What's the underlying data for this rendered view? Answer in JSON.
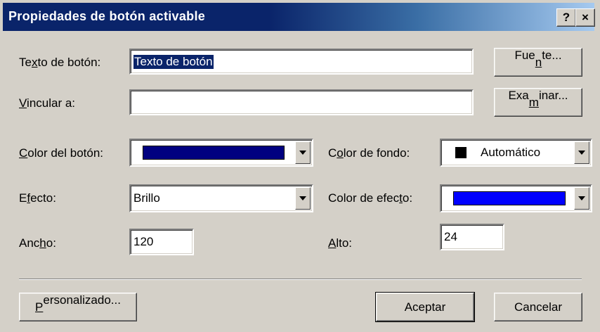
{
  "window": {
    "title": "Propiedades de botón activable",
    "help_label": "?",
    "close_label": "×"
  },
  "form": {
    "text": {
      "label_pre": "Te",
      "label_key": "x",
      "label_post": "to de botón:",
      "value": "Texto de botón"
    },
    "link": {
      "label_pre": "",
      "label_key": "V",
      "label_post": "incular a:",
      "value": ""
    },
    "button_color": {
      "label_pre": "",
      "label_key": "C",
      "label_post": "olor del botón:",
      "color": "#000080"
    },
    "background_color": {
      "label_pre": "C",
      "label_key": "o",
      "label_post": "lor de fondo:",
      "value": "Automático",
      "color": "#000000"
    },
    "effect": {
      "label_pre": "E",
      "label_key": "f",
      "label_post": "ecto:",
      "value": "Brillo"
    },
    "effect_color": {
      "label_pre": "Color de efec",
      "label_key": "t",
      "label_post": "o:",
      "color": "#0000ff"
    },
    "width": {
      "label_pre": "Anc",
      "label_key": "h",
      "label_post": "o:",
      "value": "120"
    },
    "height": {
      "label_pre": "",
      "label_key": "A",
      "label_post": "lto:",
      "value": "24"
    }
  },
  "buttons": {
    "font": {
      "pre": "Fue",
      "key": "n",
      "post": "te..."
    },
    "browse": {
      "pre": "Exa",
      "key": "m",
      "post": "inar..."
    },
    "custom": {
      "pre": "",
      "key": "P",
      "post": "ersonalizado..."
    },
    "ok": "Aceptar",
    "cancel": "Cancelar"
  }
}
